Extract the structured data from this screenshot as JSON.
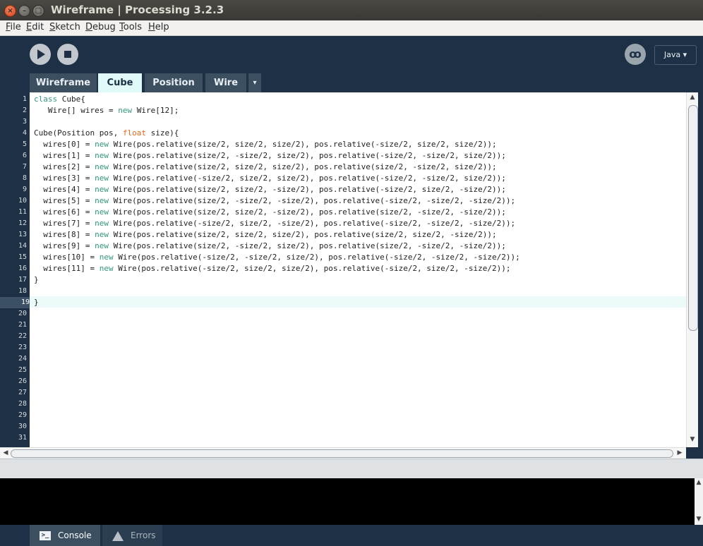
{
  "window": {
    "title": "Wireframe | Processing 3.2.3",
    "close_glyph": "×",
    "min_glyph": "–",
    "max_glyph": "□"
  },
  "menu": [
    "File",
    "Edit",
    "Sketch",
    "Debug",
    "Tools",
    "Help"
  ],
  "toolbar": {
    "mode_label": "Java ▾",
    "debug_icon": "debug-icon"
  },
  "tabs": [
    {
      "label": "Wireframe",
      "active": false
    },
    {
      "label": "Cube",
      "active": true
    },
    {
      "label": "Position",
      "active": false
    },
    {
      "label": "Wire",
      "active": false
    }
  ],
  "tab_menu_glyph": "▾",
  "editor": {
    "current_line": 19,
    "line_numbers": [
      "1",
      "2",
      "3",
      "4",
      "5",
      "6",
      "7",
      "8",
      "9",
      "10",
      "11",
      "12",
      "13",
      "14",
      "15",
      "16",
      "17",
      "18",
      "19",
      "20",
      "21",
      "22",
      "23",
      "24",
      "25",
      "26",
      "27",
      "28",
      "29",
      "30",
      "31"
    ],
    "lines": [
      "class Cube{",
      "   Wire[] wires = new Wire[12];",
      "",
      "Cube(Position pos, float size){",
      "  wires[0] = new Wire(pos.relative(size/2, size/2, size/2), pos.relative(-size/2, size/2, size/2));",
      "  wires[1] = new Wire(pos.relative(size/2, -size/2, size/2), pos.relative(-size/2, -size/2, size/2));",
      "  wires[2] = new Wire(pos.relative(size/2, size/2, size/2), pos.relative(size/2, -size/2, size/2));",
      "  wires[3] = new Wire(pos.relative(-size/2, size/2, size/2), pos.relative(-size/2, -size/2, size/2));",
      "  wires[4] = new Wire(pos.relative(size/2, size/2, -size/2), pos.relative(-size/2, size/2, -size/2));",
      "  wires[5] = new Wire(pos.relative(size/2, -size/2, -size/2), pos.relative(-size/2, -size/2, -size/2));",
      "  wires[6] = new Wire(pos.relative(size/2, size/2, -size/2), pos.relative(size/2, -size/2, -size/2));",
      "  wires[7] = new Wire(pos.relative(-size/2, size/2, -size/2), pos.relative(-size/2, -size/2, -size/2));",
      "  wires[8] = new Wire(pos.relative(size/2, size/2, size/2), pos.relative(size/2, size/2, -size/2));",
      "  wires[9] = new Wire(pos.relative(size/2, -size/2, size/2), pos.relative(size/2, -size/2, -size/2));",
      "  wires[10] = new Wire(pos.relative(-size/2, -size/2, size/2), pos.relative(-size/2, -size/2, -size/2));",
      "  wires[11] = new Wire(pos.relative(-size/2, size/2, size/2), pos.relative(-size/2, size/2, -size/2));",
      "}",
      "",
      "}"
    ]
  },
  "bottom_tabs": {
    "console": "Console",
    "errors": "Errors",
    "console_icon_glyph": ">_"
  },
  "scroll_glyphs": {
    "up": "▲",
    "down": "▼",
    "left": "◀",
    "right": "▶"
  }
}
